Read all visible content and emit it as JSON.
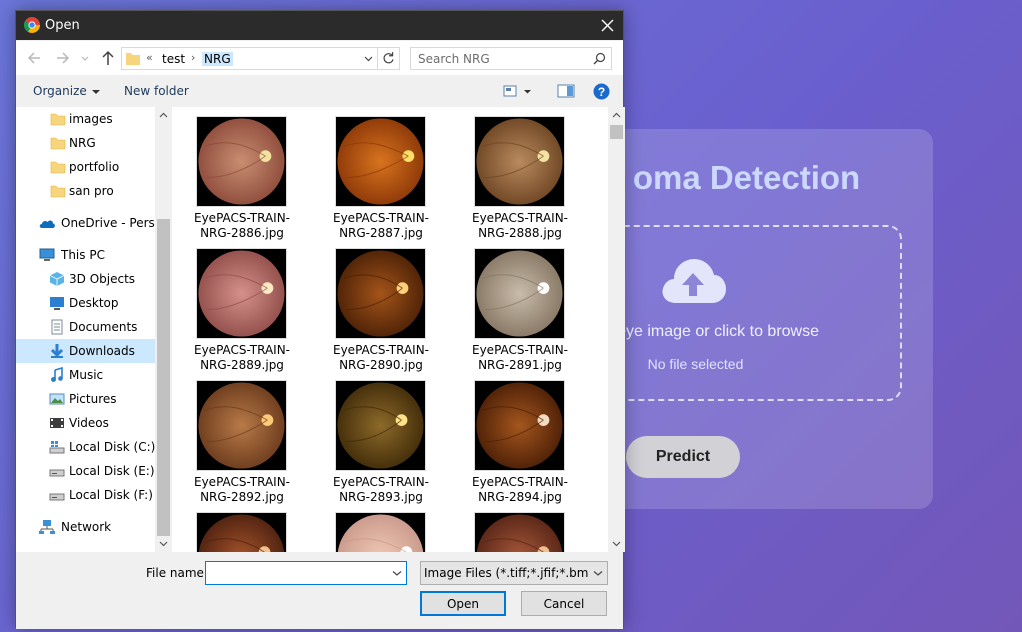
{
  "app": {
    "title": "oma Detection",
    "drop_text": "our eye image or click to browse",
    "drop_status": "No file selected",
    "predict_label": "Predict"
  },
  "dialog": {
    "title": "Open",
    "breadcrumb": {
      "overflow": "«",
      "items": [
        "test",
        "NRG"
      ]
    },
    "search_placeholder": "Search NRG",
    "toolbar": {
      "organize": "Organize",
      "new_folder": "New folder"
    },
    "nav": [
      {
        "label": "images",
        "icon": "folder-icon"
      },
      {
        "label": "NRG",
        "icon": "folder-icon"
      },
      {
        "label": "portfolio",
        "icon": "folder-icon"
      },
      {
        "label": "san pro",
        "icon": "folder-icon"
      },
      {
        "label": "OneDrive - Person",
        "icon": "onedrive-icon"
      },
      {
        "label": "This PC",
        "icon": "pc-icon"
      },
      {
        "label": "3D Objects",
        "icon": "3d-objects-icon"
      },
      {
        "label": "Desktop",
        "icon": "desktop-icon"
      },
      {
        "label": "Documents",
        "icon": "documents-icon"
      },
      {
        "label": "Downloads",
        "icon": "downloads-icon",
        "selected": true
      },
      {
        "label": "Music",
        "icon": "music-icon"
      },
      {
        "label": "Pictures",
        "icon": "pictures-icon"
      },
      {
        "label": "Videos",
        "icon": "videos-icon"
      },
      {
        "label": "Local Disk (C:)",
        "icon": "windows-drive-icon"
      },
      {
        "label": "Local Disk (E:)",
        "icon": "drive-icon"
      },
      {
        "label": "Local Disk (F:)",
        "icon": "drive-icon"
      },
      {
        "label": "Network",
        "icon": "network-icon"
      }
    ],
    "files": [
      {
        "line1": "EyePACS-TRAIN-",
        "line2": "NRG-2886.jpg"
      },
      {
        "line1": "EyePACS-TRAIN-",
        "line2": "NRG-2887.jpg"
      },
      {
        "line1": "EyePACS-TRAIN-",
        "line2": "NRG-2888.jpg"
      },
      {
        "line1": "EyePACS-TRAIN-",
        "line2": "NRG-2889.jpg"
      },
      {
        "line1": "EyePACS-TRAIN-",
        "line2": "NRG-2890.jpg"
      },
      {
        "line1": "EyePACS-TRAIN-",
        "line2": "NRG-2891.jpg"
      },
      {
        "line1": "EyePACS-TRAIN-",
        "line2": "NRG-2892.jpg"
      },
      {
        "line1": "EyePACS-TRAIN-",
        "line2": "NRG-2893.jpg"
      },
      {
        "line1": "EyePACS-TRAIN-",
        "line2": "NRG-2894.jpg"
      },
      {
        "line1": "",
        "line2": ""
      },
      {
        "line1": "",
        "line2": ""
      },
      {
        "line1": "",
        "line2": ""
      }
    ],
    "file_name_label": "File name:",
    "file_name_value": "",
    "file_type": "Image Files (*.tiff;*.jfif;*.bmp;*.pjp",
    "open_label": "Open",
    "cancel_label": "Cancel"
  },
  "colors": {
    "background_start": "#6b76d9",
    "background_end": "#7357b8",
    "titlebar": "#2b2b2b",
    "selection": "#cce8ff",
    "accent": "#0078d7",
    "help": "#1b6ac9"
  }
}
